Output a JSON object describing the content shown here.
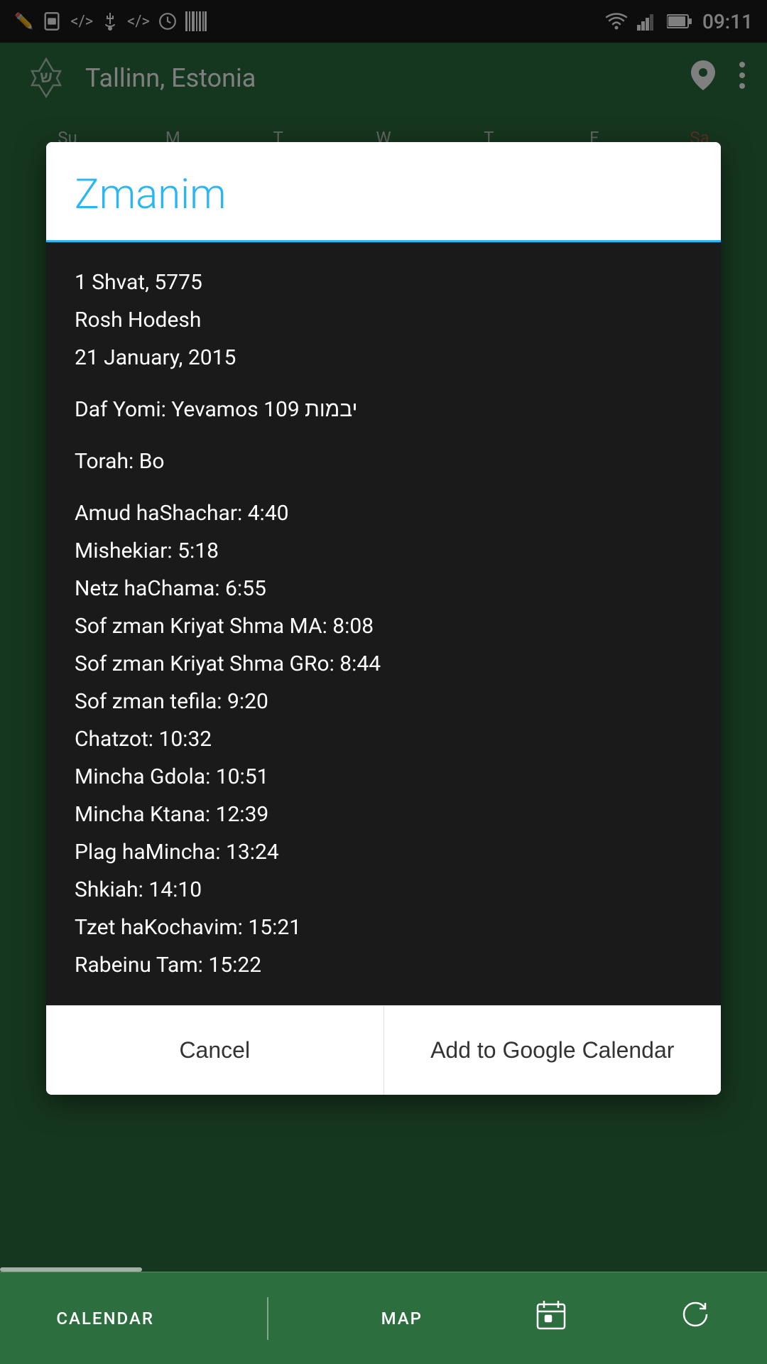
{
  "statusBar": {
    "time": "09:11",
    "icons": {
      "left": [
        "edit-icon",
        "sim-icon",
        "code-icon",
        "usb-icon",
        "code2-icon",
        "clock-icon",
        "barcode-icon"
      ],
      "right": [
        "wifi-icon",
        "signal-icon",
        "battery-icon"
      ]
    }
  },
  "appHeader": {
    "title": "Tallinn, Estonia",
    "locationIconLabel": "location-icon",
    "menuIconLabel": "menu-icon"
  },
  "dialog": {
    "title": "Zmanim",
    "dateLines": {
      "hebrewDate": "1 Shvat, 5775",
      "holiday": "Rosh Hodesh",
      "gregorianDate": "21 January, 2015"
    },
    "dafYomi": "Daf Yomi: Yevamos 109 יבמות",
    "torah": "Torah: Bo",
    "times": [
      "Amud haShachar: 4:40",
      "Mishekiar: 5:18",
      "Netz haChama: 6:55",
      "Sof zman Kriyat Shma MA: 8:08",
      "Sof zman Kriyat Shma GRo: 8:44",
      "Sof zman tefila: 9:20",
      "Chatzot: 10:32",
      "Mincha Gdola: 10:51",
      "Mincha Ktana: 12:39",
      "Plag haMincha: 13:24",
      "Shkiah: 14:10",
      "Tzet haKochavim: 15:21",
      "Rabeinu Tam: 15:22"
    ],
    "cancelButton": "Cancel",
    "addCalendarButton": "Add to Google Calendar"
  },
  "bottomNav": {
    "calendarLabel": "CALENDAR",
    "mapLabel": "MAP",
    "calendarIconLabel": "calendar-icon",
    "refreshIconLabel": "refresh-icon"
  }
}
